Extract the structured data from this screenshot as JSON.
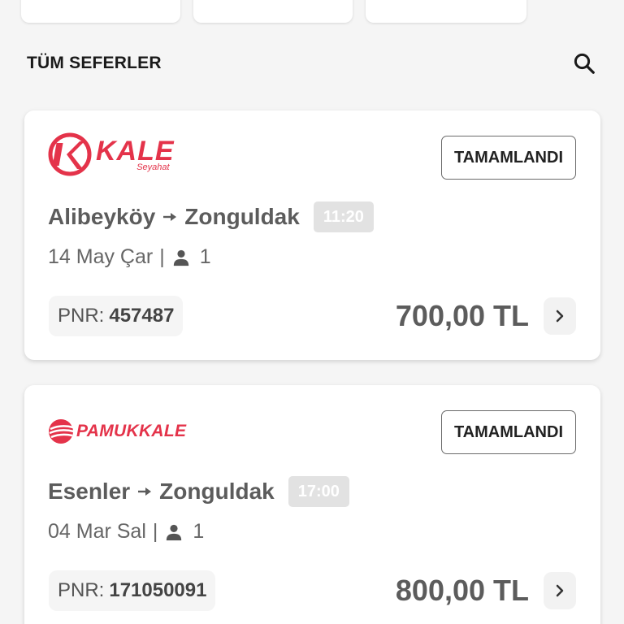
{
  "section": {
    "title": "TÜM SEFERLER",
    "search_icon": "search-icon"
  },
  "trips": [
    {
      "operator": {
        "name": "KALE",
        "subtitle": "Seyahat"
      },
      "status": "TAMAMLANDI",
      "from": "Alibeyköy",
      "to": "Zonguldak",
      "time": "11:20",
      "date": "14 May Çar",
      "passengers": "1",
      "pnr_label": "PNR:",
      "pnr": "457487",
      "price": "700,00 TL"
    },
    {
      "operator": {
        "name": "PAMUKKALE"
      },
      "status": "TAMAMLANDI",
      "from": "Esenler",
      "to": "Zonguldak",
      "time": "17:00",
      "date": "04 Mar Sal",
      "passengers": "1",
      "pnr_label": "PNR:",
      "pnr": "171050091",
      "price": "800,00 TL"
    }
  ],
  "colors": {
    "brand_red": "#e4334a",
    "text_dark": "#1a1a1a",
    "text_gray": "#5c5c5c",
    "badge_gray": "#e2e2e2"
  }
}
